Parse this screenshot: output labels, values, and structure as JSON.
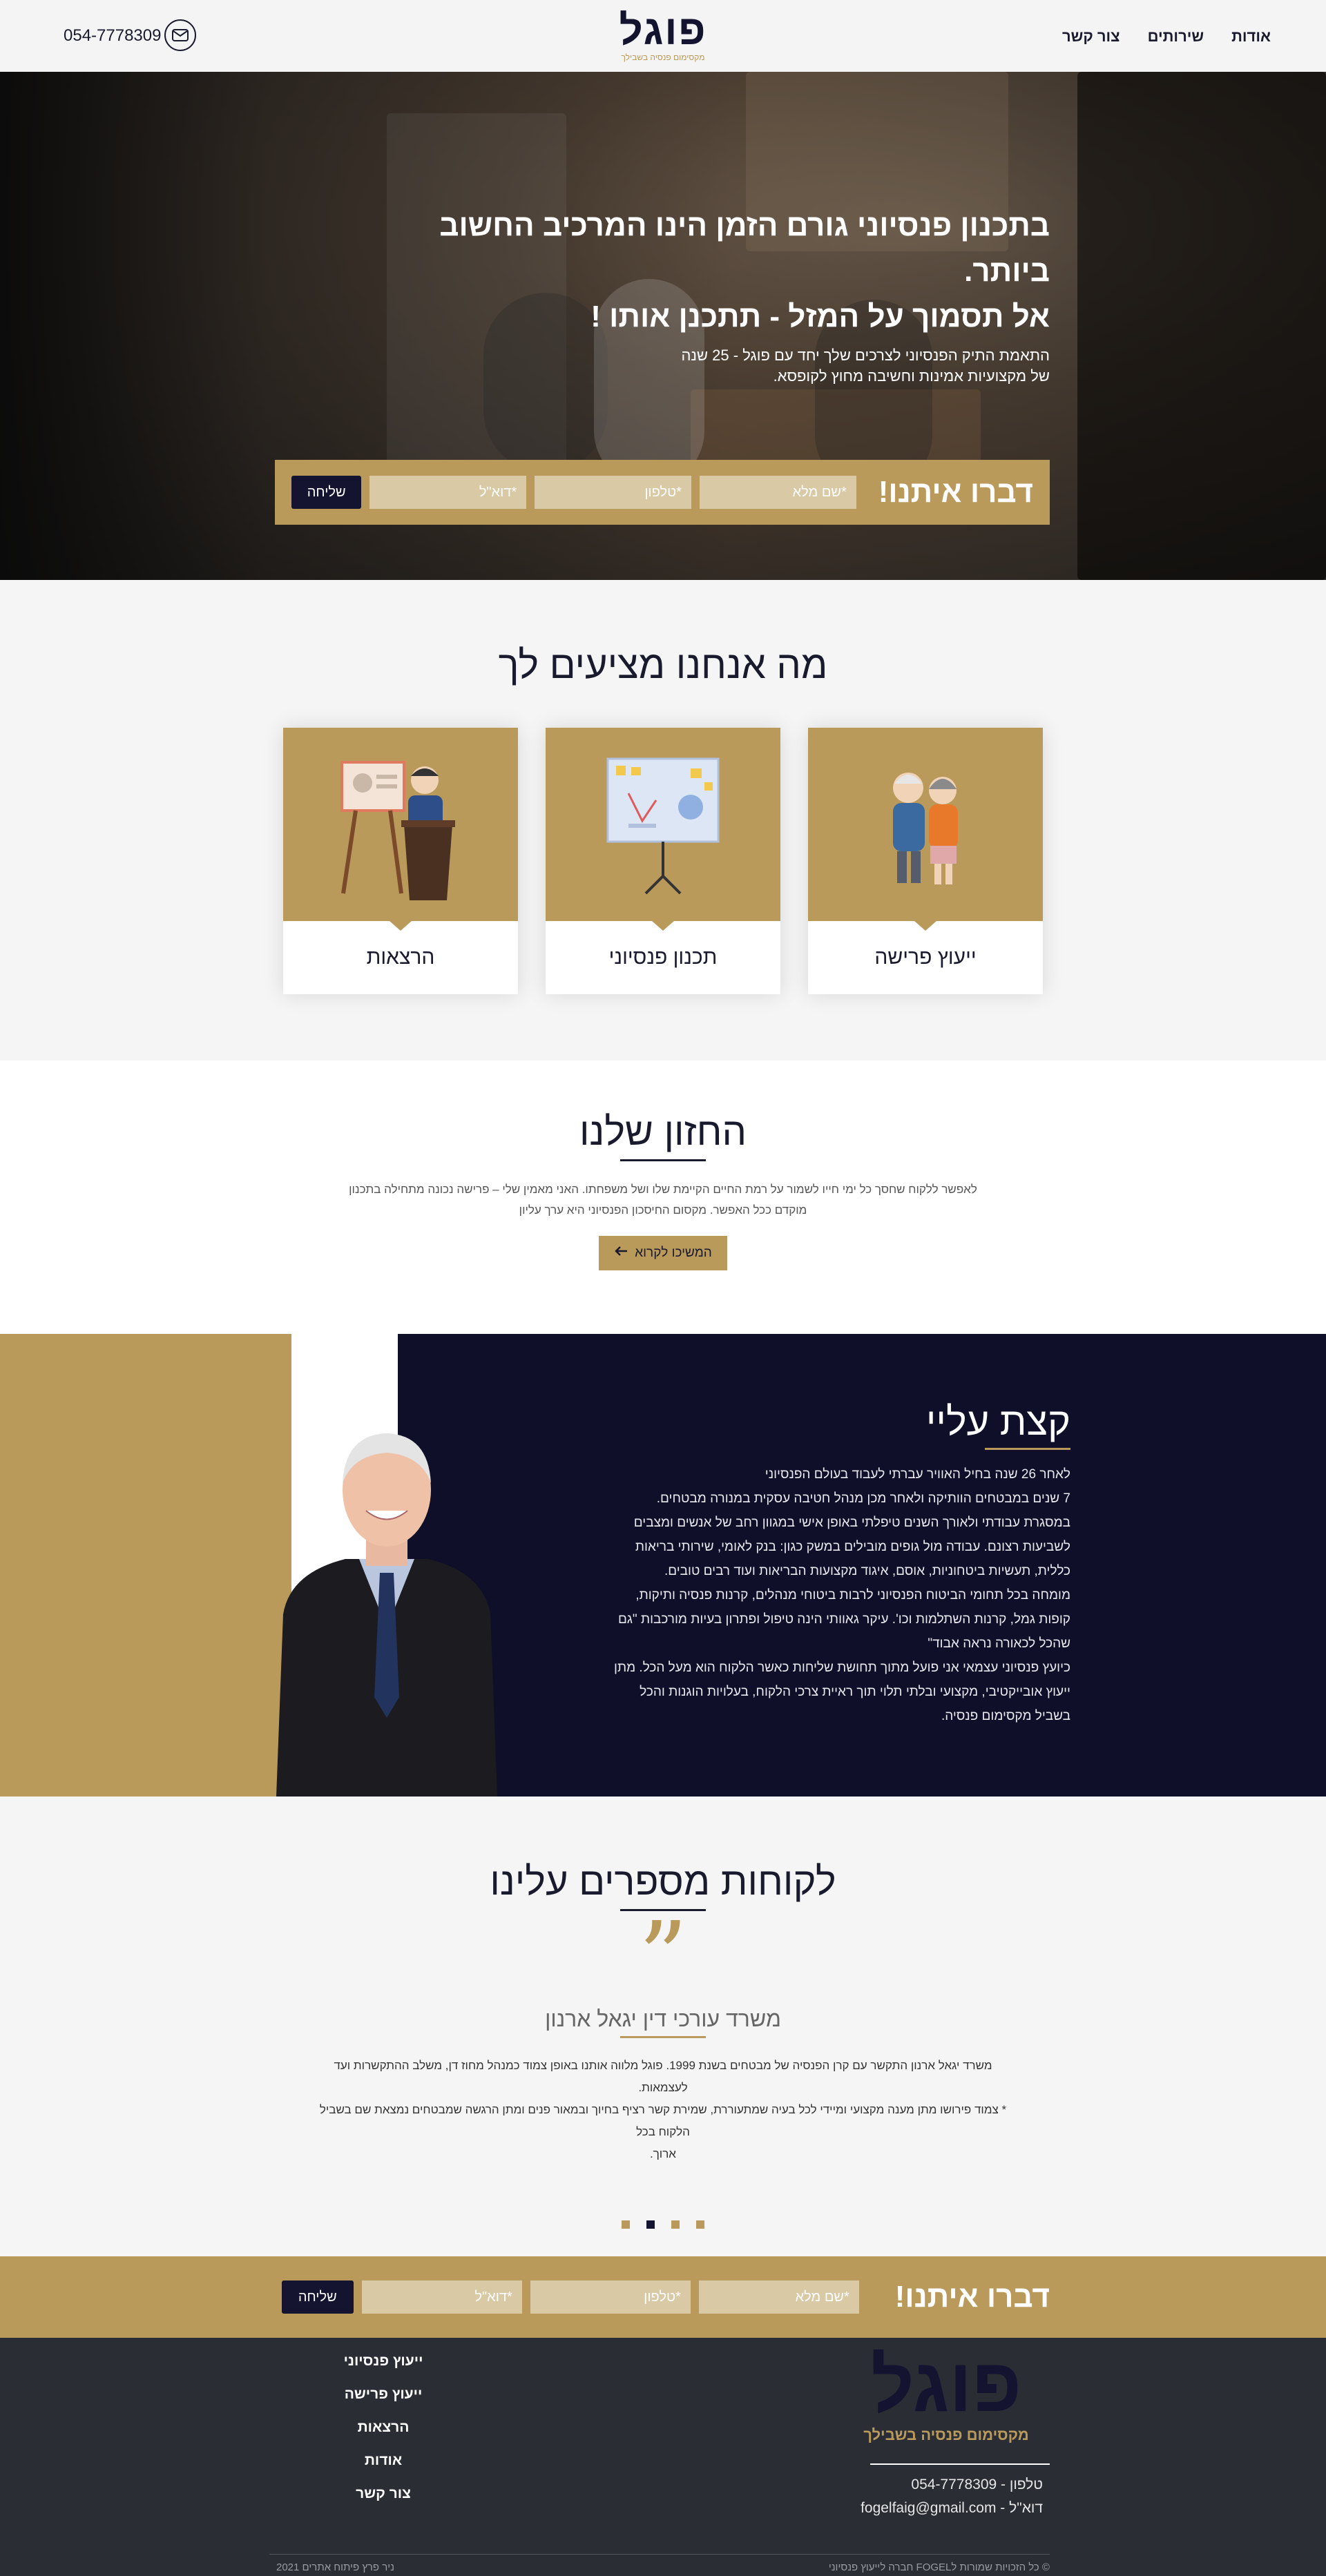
{
  "header": {
    "nav": [
      "אודות",
      "שירותים",
      "צור קשר"
    ],
    "logo_text": "פוגל",
    "logo_tagline": "מקסימום פנסיה בשבילך",
    "phone": "054-7778309"
  },
  "hero": {
    "line1": "בתכנון פנסיוני גורם הזמן הינו המרכיב החשוב ביותר.",
    "line2": "אל תסמוך על המזל - תתכנן אותו !",
    "sub1": "התאמת התיק הפנסיוני לצרכים שלך יחד עם פוגל - 25 שנה",
    "sub2": "של מקצועיות אמינות וחשיבה מחוץ לקופסא.",
    "form": {
      "title": "דברו איתנו!",
      "name_placeholder": "*שם מלא",
      "phone_placeholder": "*טלפון",
      "email_placeholder": "*דוא\"ל",
      "submit": "שליחה"
    }
  },
  "services": {
    "title": "מה אנחנו מציעים לך",
    "cards": [
      {
        "label": "ייעוץ פרישה",
        "icon": "elderly-couple-icon"
      },
      {
        "label": "תכנון פנסיוני",
        "icon": "presentation-board-icon"
      },
      {
        "label": "הרצאות",
        "icon": "lecturer-podium-icon"
      }
    ]
  },
  "vision": {
    "title": "החזון שלנו",
    "text1": "לאפשר ללקוח שחסך כל ימי חייו לשמור על רמת החיים הקיימת שלו ושל משפחתו. האני מאמין שלי – פרישה נכונה מתחילה בתכנון",
    "text2": "מוקדם ככל האפשר. מקסום החיסכון הפנסיוני היא ערך עליון",
    "button": "המשיכו לקרוא"
  },
  "about": {
    "title": "קצת עליי",
    "lines": [
      "לאחר 26 שנה בחיל האוויר עברתי לעבוד בעולם הפנסיוני",
      "7 שנים במבטחים הוותיקה ולאחר מכן מנהל חטיבה עסקית במנורה מבטחים.",
      "במסגרת עבודתי ולאורך השנים טיפלתי באופן אישי במגוון רחב של אנשים ומצבים",
      "לשביעות רצונם. עבודה מול גופים מובילים במשק כגון: בנק לאומי, שירותי בריאות",
      "כללית, תעשיות ביטחוניות, אוסם, איגוד מקצועות הבריאות ועוד רבים טובים.",
      "מומחה בכל תחומי הביטוח הפנסיוני לרבות ביטוחי מנהלים, קרנות פנסיה ותיקות,",
      "קופות גמל, קרנות השתלמות וכו'. עיקר גאוותי הינה טיפול ופתרון בעיות מורכבות \"גם",
      "שהכל לכאורה נראה אבוד\"",
      "כיועץ פנסיוני עצמאי אני פועל מתוך תחושת שליחות כאשר הלקוח הוא מעל הכל. מתן",
      "ייעוץ אובייקטיבי, מקצועי ובלתי תלוי תוך ראיית צרכי הלקוח, בעלויות הוגנות והכל",
      "בשביל מקסימום פנסיה."
    ]
  },
  "testimonials": {
    "title": "לקוחות מספרים עלינו",
    "author": "משרד עורכי דין יגאל ארנון",
    "text1": "משרד יגאל ארנון התקשר עם קרן הפנסיה של מבטחים בשנת 1999. פוגל מלווה אותנו באופן צמוד כמנהל מחוז דן, משלב ההתקשרות ועד לעצמאות.",
    "text2": "* צמוד פירושו מתן מענה מקצועי ומיידי לכל בעיה שמתעוררת, שמירת קשר רציף בחיוך ובמאור פנים ומתן הרגשה שמבטחים נמצאת שם בשביל הלקוח בכל",
    "text3": "ארוך.",
    "dots_count": 4,
    "active_dot": 2
  },
  "cta": {
    "title": "דברו איתנו!",
    "name_placeholder": "*שם מלא",
    "phone_placeholder": "*טלפון",
    "email_placeholder": "*דוא\"ל",
    "submit": "שליחה"
  },
  "footer": {
    "logo_text": "פוגל",
    "tagline": "מקסימום פנסיה בשבילך",
    "phone_line": "טלפון - 054-7778309",
    "email_line": "דוא\"ל - fogelfaig@gmail.com",
    "links": [
      "ייעוץ פנסיוני",
      "ייעוץ פרישה",
      "הרצאות",
      "אודות",
      "צור קשר"
    ],
    "copyright": "© כל הזכויות שמורות לFOGEL חברה לייעוץ פנסיוני",
    "credit": "ניר פרץ פיתוח אתרים 2021"
  },
  "colors": {
    "gold": "#b99a5b",
    "navy": "#141431",
    "footer": "#2b2d35"
  }
}
